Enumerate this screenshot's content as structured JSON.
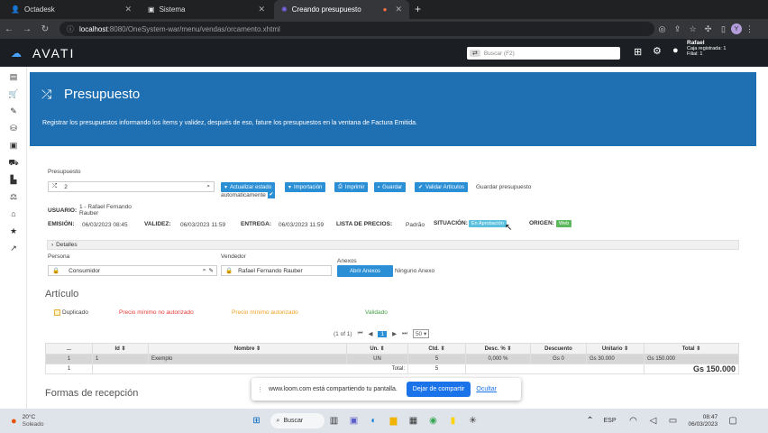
{
  "browser": {
    "tabs": [
      {
        "label": "Octadesk",
        "icon": "person-icon"
      },
      {
        "label": "Sistema",
        "icon": "page-icon"
      },
      {
        "label": "Creando presupuesto",
        "icon": "loom-icon"
      }
    ],
    "url_host": "localhost",
    "url_path": ":8080/OneSystem-war/menu/vendas/orcamento.xhtml"
  },
  "app": {
    "logo": "AVATI",
    "search_placeholder": "Buscar (F2)",
    "user_name": "Rafael",
    "user_line2": "Caja registrada: 1",
    "user_line3": "Filial: 1"
  },
  "banner": {
    "title": "Presupuesto",
    "description": "Registrar los presupuestos informando los ítems y validez, después de eso, fature los presupuestos en la ventana de Factura Emitida."
  },
  "form": {
    "presupuesto_label": "Presupuesto",
    "presupuesto_value": "2",
    "buttons": {
      "actualizar": "Actualizar estado",
      "importacion": "Importación",
      "imprimir": "Imprimir",
      "guardar": "Guardar",
      "validar": "Validar Artículos"
    },
    "guardar_auto_label_1": "Guardar presupuesto",
    "guardar_auto_label_2": "automaticamente",
    "usuario_label": "USUARIO:",
    "usuario_value_1": "1 - Rafael Fernando",
    "usuario_value_2": "Rauber",
    "emision_label": "EMISIÓN:",
    "emision_value": "06/03/2023 08:45",
    "validez_label": "VALIDEZ:",
    "validez_value": "06/03/2023 11:59",
    "entrega_label": "ENTREGA:",
    "entrega_value": "06/03/2023 11:59",
    "lista_label": "LISTA DE PRECIOS:",
    "lista_value": "Padrão",
    "situacion_label": "SITUACIÓN:",
    "situacion_value": "En Aprobación",
    "origen_label": "ORIGEN:",
    "origen_value": "Web",
    "detalles": "Detalles",
    "persona_label": "Persona",
    "persona_value": "Consumidor",
    "vendedor_label": "Vendedor",
    "vendedor_value": "Rafael Fernando Rauber",
    "anexos_label": "Anexos",
    "abrir_anexos": "Abrir Anexos",
    "ninguno_anexo": "Ninguno Anexo"
  },
  "articulo": {
    "title": "Artículo",
    "legend_duplicado": "Duplicado",
    "legend_no_autorizado": "Precio mínimo no autorizado",
    "legend_autorizado": "Precio mínimo autorizado",
    "legend_validado": "Validado",
    "pager_text": "(1 of 1)",
    "pager_page": "1",
    "pager_size": "50",
    "columns": [
      "...",
      "Id",
      "Nombre",
      "Un.",
      "Ctd.",
      "Desc. %",
      "Descuento",
      "Unitario",
      "Total"
    ],
    "row": [
      "1",
      "1",
      "Exemplo",
      "UN",
      "5",
      "0,000 %",
      "Gs 0",
      "Gs 30.000",
      "Gs 150.000"
    ],
    "footer_count": "1",
    "footer_total_label": "Total:",
    "footer_qty": "5",
    "footer_total": "Gs 150.000"
  },
  "formas": {
    "title": "Formas de recepción"
  },
  "loom": {
    "message": "www.loom.com está compartiendo tu pantalla.",
    "stop": "Dejar de compartir",
    "hide": "Ocultar"
  },
  "taskbar": {
    "temp": "20°C",
    "weather": "Soleado",
    "search": "Buscar",
    "lang": "ESP",
    "time": "08:47",
    "date": "06/03/2023"
  },
  "colors": {
    "primary": "#2b8fd6",
    "banner": "#1f6fb3",
    "status": "#5bc0de",
    "origin": "#5cb85c"
  }
}
